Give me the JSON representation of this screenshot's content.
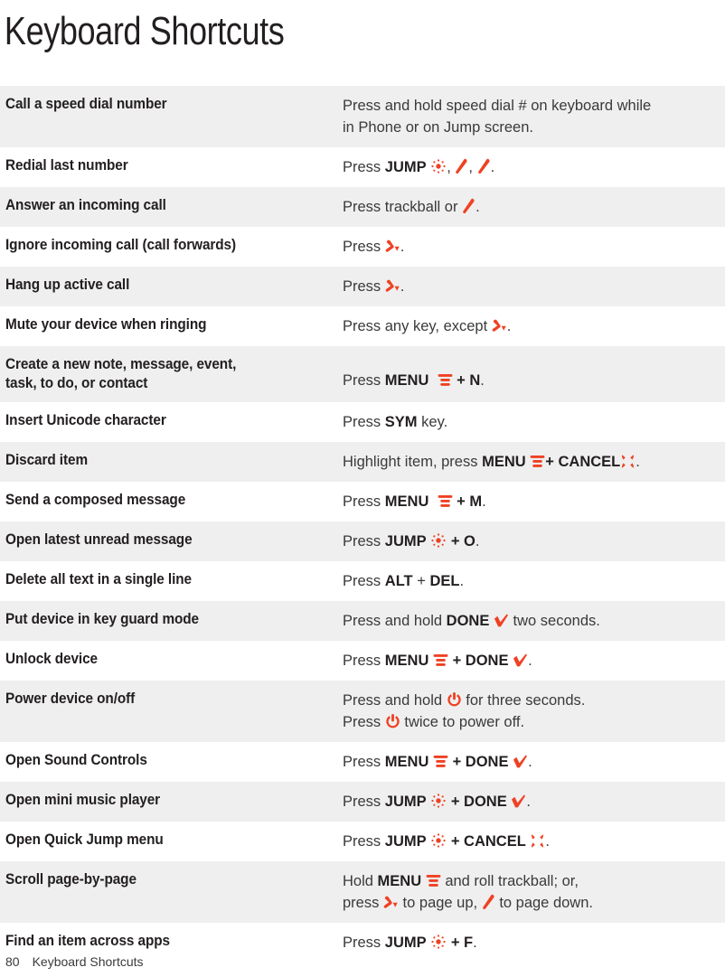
{
  "document": {
    "title": "Keyboard Shortcuts",
    "accent_color": "#ef4123",
    "text_color": "#231f20",
    "stripe_color": "#efefef",
    "background_color": "#ffffff"
  },
  "footer": {
    "page_number": "80",
    "section_label": "Keyboard Shortcuts"
  },
  "table": {
    "rows": [
      {
        "action": "Call a speed dial number",
        "desc_lines": [
          "Press and hold speed dial # on keyboard while",
          "in Phone or on Jump screen."
        ],
        "icons": []
      },
      {
        "action": "Redial last number",
        "desc_lines": [
          "Press JUMP , , ."
        ],
        "icons": [
          "jump-icon",
          "phone-send-icon",
          "phone-send-icon"
        ]
      },
      {
        "action": "Answer an incoming call",
        "desc_lines": [
          "Press trackball or ."
        ],
        "icons": [
          "phone-send-icon"
        ]
      },
      {
        "action": "Ignore incoming call (call forwards)",
        "desc_lines": [
          "Press ."
        ],
        "icons": [
          "phone-end-icon"
        ]
      },
      {
        "action": "Hang up active call",
        "desc_lines": [
          "Press ."
        ],
        "icons": [
          "phone-end-icon"
        ]
      },
      {
        "action": "Mute your device when ringing",
        "desc_lines": [
          "Press any key, except ."
        ],
        "icons": [
          "phone-end-icon"
        ]
      },
      {
        "action": "Create a new note, message, event, task, to do, or contact",
        "action_lines": [
          "Create a new note, message, event,",
          "task, to do, or contact"
        ],
        "desc_lines": [
          "Press MENU  + N."
        ],
        "icons": [
          "menu-icon"
        ]
      },
      {
        "action": "Insert Unicode character",
        "desc_lines": [
          "Press SYM key."
        ],
        "icons": []
      },
      {
        "action": "Discard item",
        "desc_lines": [
          "Highlight item, press MENU + CANCEL ."
        ],
        "icons": [
          "menu-icon",
          "cancel-icon"
        ]
      },
      {
        "action": "Send a composed message",
        "desc_lines": [
          "Press MENU  + M."
        ],
        "icons": [
          "menu-icon"
        ]
      },
      {
        "action": "Open latest unread message",
        "desc_lines": [
          "Press JUMP  + O."
        ],
        "icons": [
          "jump-icon"
        ]
      },
      {
        "action": "Delete all text in a single line",
        "desc_lines": [
          "Press ALT + DEL."
        ],
        "icons": []
      },
      {
        "action": "Put device in key guard mode",
        "desc_lines": [
          "Press and hold DONE  two seconds."
        ],
        "icons": [
          "done-icon"
        ]
      },
      {
        "action": "Unlock device",
        "desc_lines": [
          "Press MENU  + DONE ."
        ],
        "icons": [
          "menu-icon",
          "done-icon"
        ]
      },
      {
        "action": "Power device on/off",
        "desc_lines": [
          "Press and hold  for three seconds.",
          "Press  twice to power off."
        ],
        "icons": [
          "power-icon",
          "power-icon"
        ]
      },
      {
        "action": "Open Sound Controls",
        "desc_lines": [
          "Press MENU  + DONE ."
        ],
        "icons": [
          "menu-icon",
          "done-icon"
        ]
      },
      {
        "action": "Open mini music player",
        "desc_lines": [
          "Press JUMP  + DONE ."
        ],
        "icons": [
          "jump-icon",
          "done-icon"
        ]
      },
      {
        "action": "Open Quick Jump menu",
        "desc_lines": [
          "Press JUMP  + CANCEL ."
        ],
        "icons": [
          "jump-icon",
          "cancel-icon"
        ]
      },
      {
        "action": "Scroll page-by-page",
        "desc_lines": [
          "Hold MENU  and roll trackball; or,",
          "press  to page up,  to page down."
        ],
        "icons": [
          "menu-icon",
          "phone-end-icon",
          "phone-send-icon"
        ]
      },
      {
        "action": "Find an item across apps",
        "desc_lines": [
          "Press JUMP  + F."
        ],
        "icons": [
          "jump-icon"
        ]
      }
    ],
    "text": {
      "r0a": "Call a speed dial number",
      "r0d1": "Press and hold speed dial # on keyboard while",
      "r0d2": "in Phone or on Jump screen.",
      "r1a": "Redial last number",
      "r1_press": "Press",
      "r1_jump": "JUMP",
      "r2a": "Answer an incoming call",
      "r2_press": "Press trackball or",
      "r3a": "Ignore incoming call (call forwards)",
      "r3_press": "Press",
      "r4a": "Hang up active call",
      "r4_press": "Press",
      "r5a": "Mute your device when ringing",
      "r5_press": "Press any key, except",
      "r6a1": "Create a new note, message, event,",
      "r6a2": "task, to do, or contact",
      "r6_press": "Press",
      "r6_menu": "MENU",
      "r6_plus": "+",
      "r6_key": "N",
      "r7a": "Insert Unicode character",
      "r7_press": "Press",
      "r7_sym": "SYM",
      "r7_key": "key.",
      "r8a": "Discard item",
      "r8_press": "Highlight item, press",
      "r8_menu": "MENU",
      "r8_plus": "+",
      "r8_cancel": "CANCEL",
      "r9a": "Send a composed message",
      "r9_press": "Press",
      "r9_menu": "MENU",
      "r9_plus": "+",
      "r9_key": "M",
      "r10a": "Open latest unread message",
      "r10_press": "Press",
      "r10_jump": "JUMP",
      "r10_plus": "+",
      "r10_key": "O",
      "r11a": "Delete all text in a single line",
      "r11_press": "Press",
      "r11_alt": "ALT",
      "r11_plus": "+",
      "r11_del": "DEL",
      "r12a": "Put device in key guard mode",
      "r12_press": "Press and hold",
      "r12_done": "DONE",
      "r12_tail": "two seconds.",
      "r13a": "Unlock device",
      "r13_press": "Press",
      "r13_menu": "MENU",
      "r13_plus": "+",
      "r13_done": "DONE",
      "r14a": "Power device on/off",
      "r14_d1a": "Press and hold",
      "r14_d1b": "for three seconds.",
      "r14_d2a": "Press",
      "r14_d2b": "twice to power off.",
      "r15a": "Open Sound Controls",
      "r15_press": "Press",
      "r15_menu": "MENU",
      "r15_plus": "+",
      "r15_done": "DONE",
      "r16a": "Open mini music player",
      "r16_press": "Press",
      "r16_jump": "JUMP",
      "r16_plus": "+",
      "r16_done": "DONE",
      "r17a": "Open Quick Jump menu",
      "r17_press": "Press",
      "r17_jump": "JUMP",
      "r17_plus": "+",
      "r17_cancel": "CANCEL",
      "r18a": "Scroll page-by-page",
      "r18_hold": "Hold",
      "r18_menu": "MENU",
      "r18_tail1": "and roll trackball; or,",
      "r18_press": "press",
      "r18_mid": "to page up,",
      "r18_tail2": "to page down.",
      "r19a": "Find an item across apps",
      "r19_press": "Press",
      "r19_jump": "JUMP",
      "r19_plus": "+",
      "r19_key": "F",
      "period": "."
    }
  }
}
